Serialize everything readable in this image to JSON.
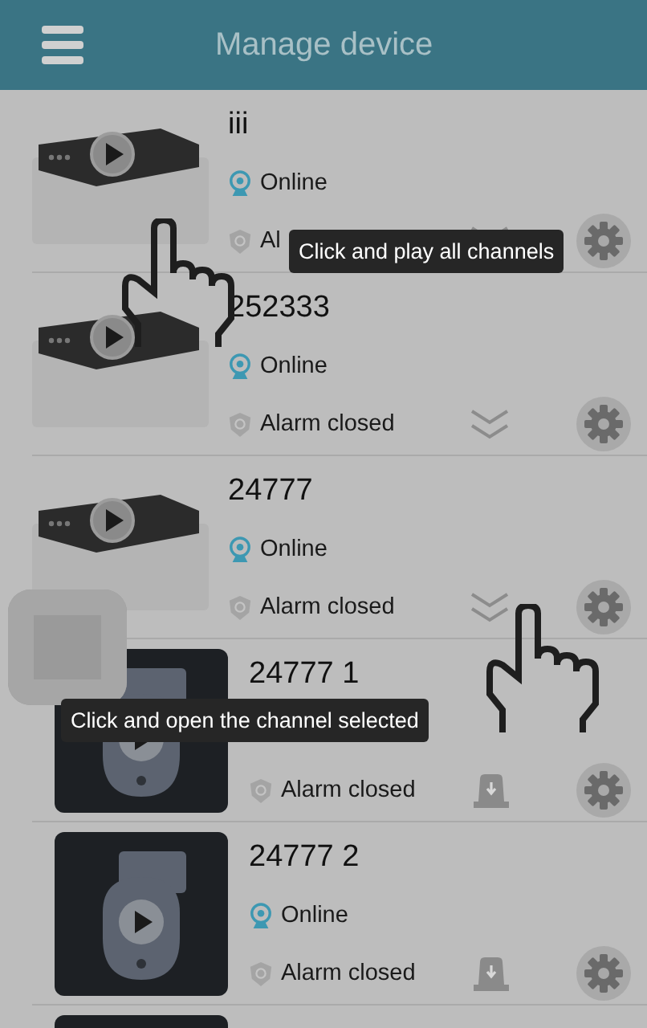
{
  "header": {
    "title": "Manage device"
  },
  "rows": [
    {
      "kind": "device",
      "name": "iii",
      "status": "Online",
      "alarm": "Al"
    },
    {
      "kind": "device",
      "name": "252333",
      "status": "Online",
      "alarm": "Alarm closed"
    },
    {
      "kind": "device",
      "name": "24777",
      "status": "Online",
      "alarm": "Alarm closed"
    },
    {
      "kind": "channel",
      "name": "24777 1",
      "alarm": "Alarm closed"
    },
    {
      "kind": "channel",
      "name": "24777 2",
      "status": "Online",
      "alarm": "Alarm closed"
    },
    {
      "kind": "channel"
    }
  ],
  "tips": [
    {
      "text": "Click and play all channels"
    },
    {
      "text": "Click and open the channel selected"
    }
  ]
}
